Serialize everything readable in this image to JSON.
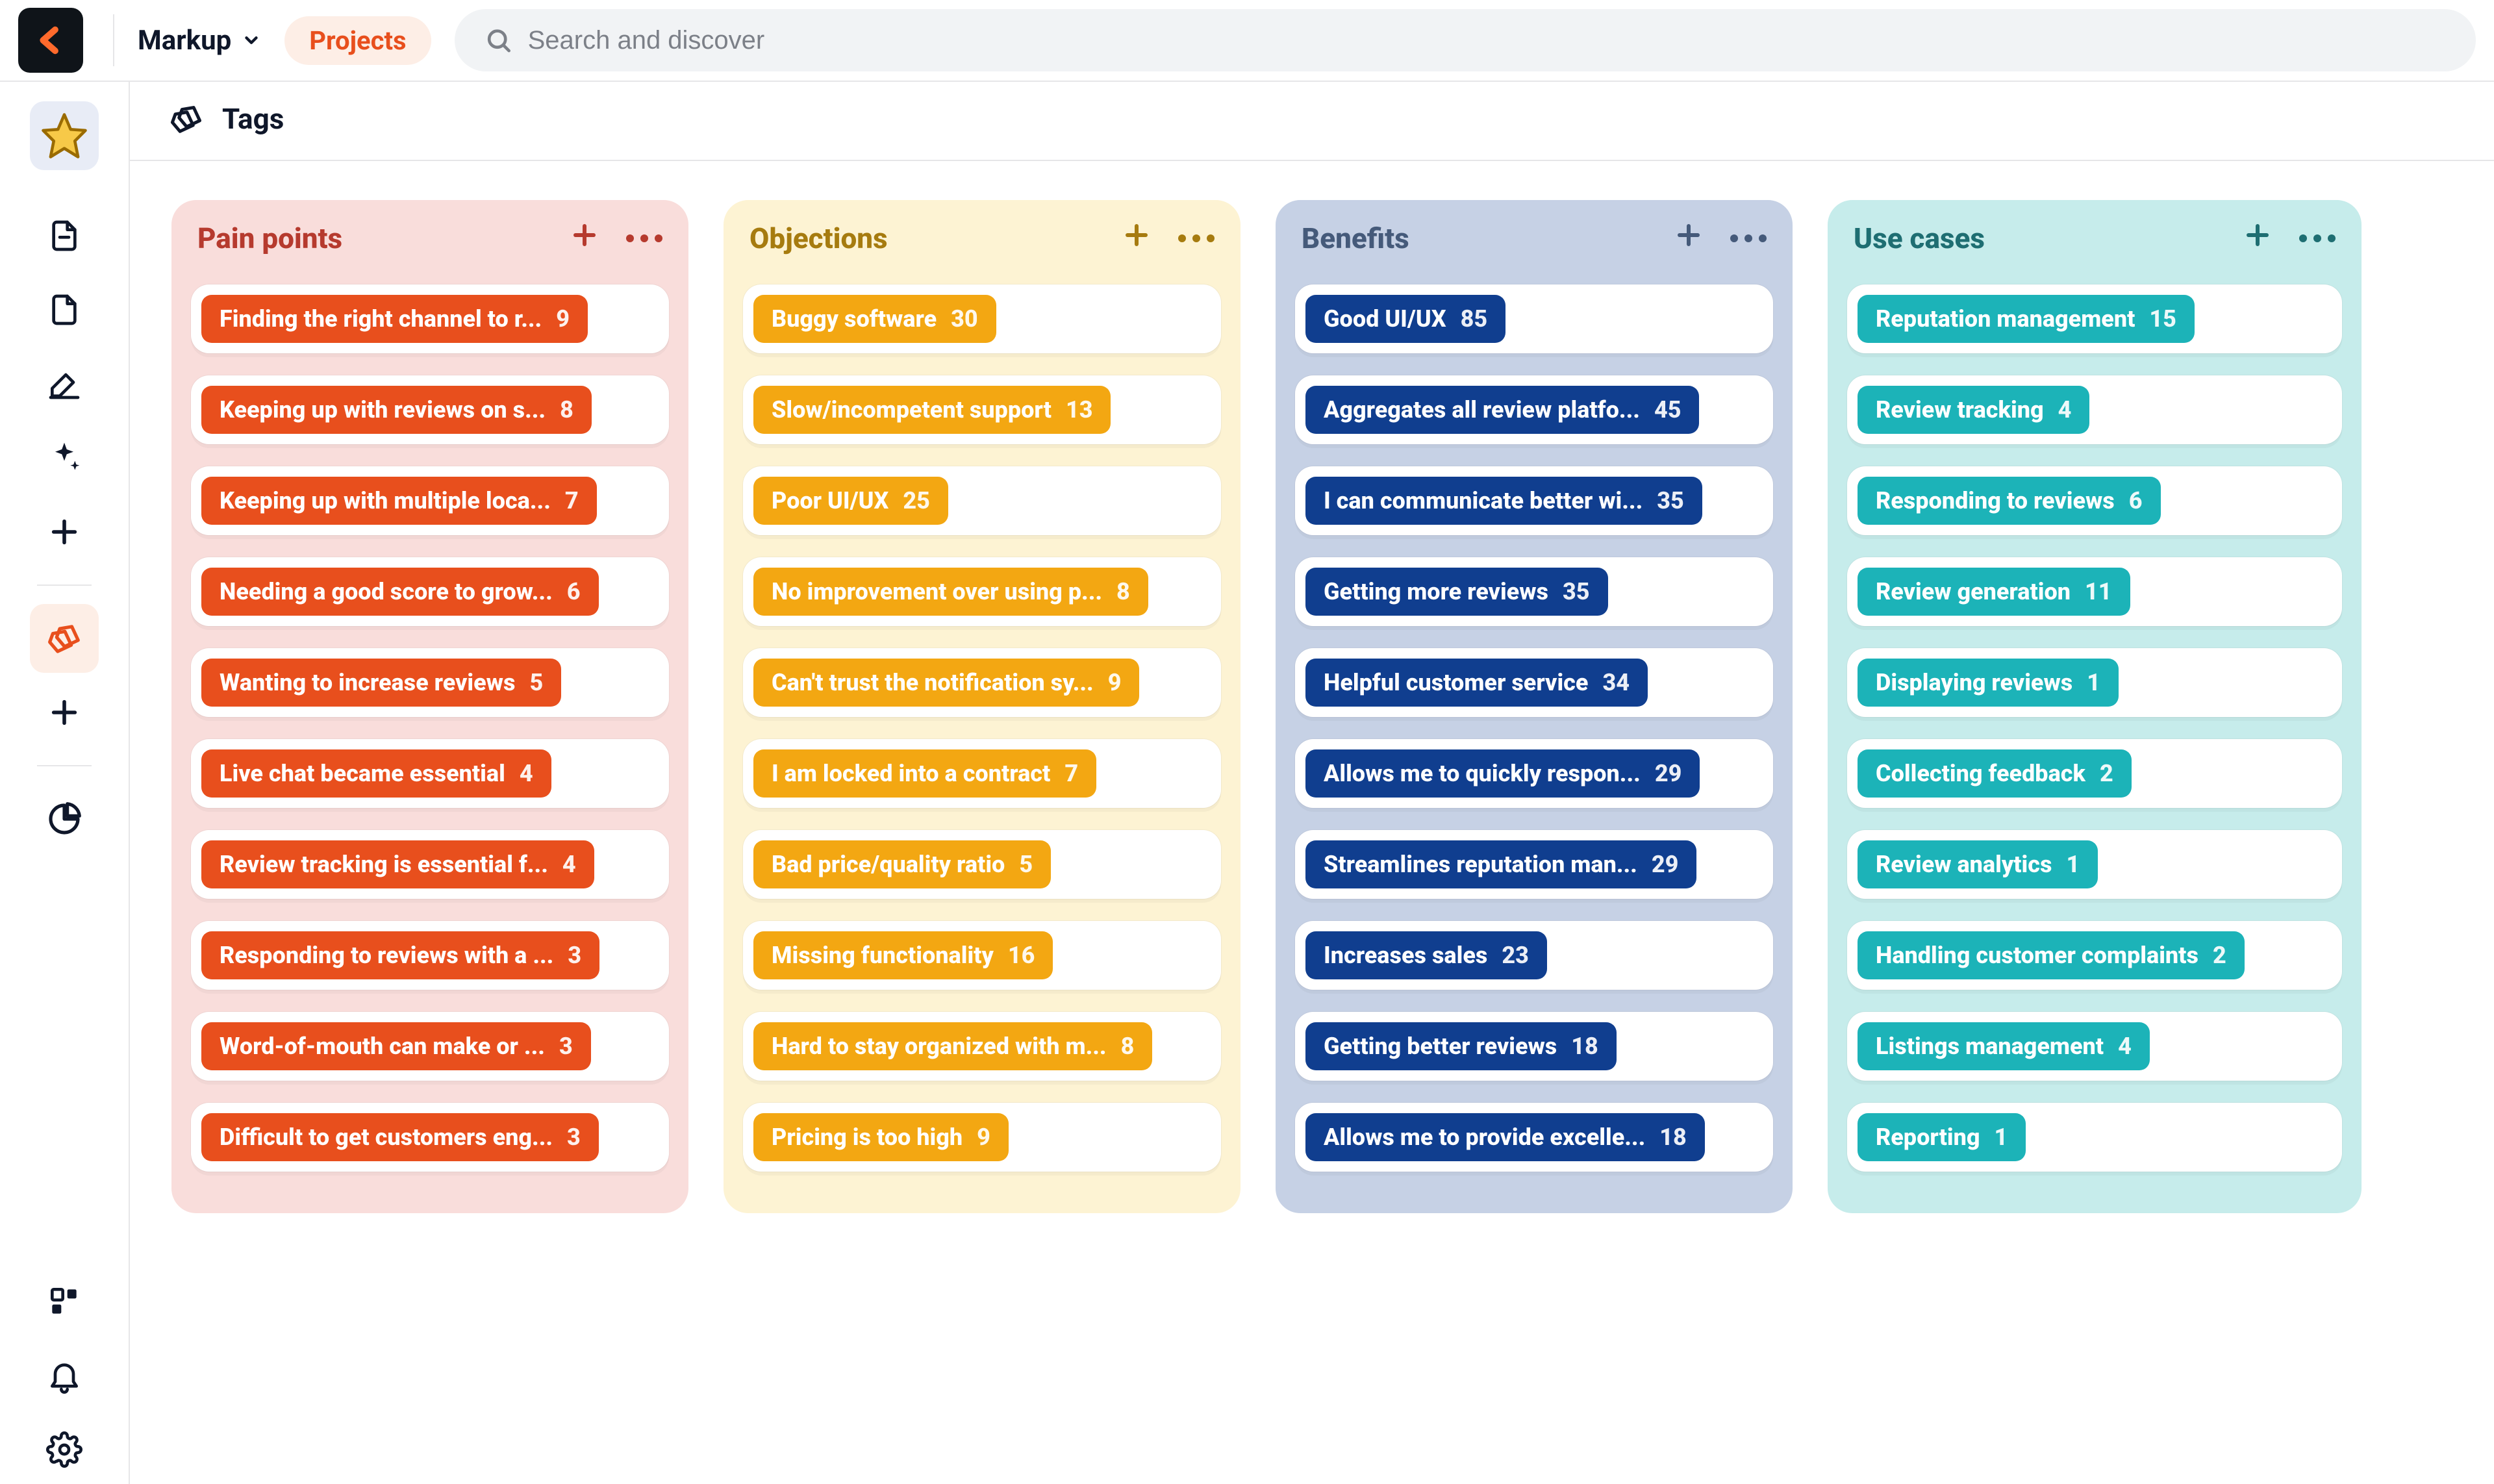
{
  "header": {
    "workspace_name": "Markup",
    "projects_label": "Projects",
    "search_placeholder": "Search and discover"
  },
  "page": {
    "title": "Tags"
  },
  "columns": [
    {
      "id": "pain_points",
      "title": "Pain points",
      "bg_class": "col-pain",
      "title_class": "title-pain",
      "pill_class": "pill-pain",
      "dot_class": "dot-pain",
      "items": [
        {
          "label": "Finding the right channel to r...",
          "count": 9
        },
        {
          "label": "Keeping up with reviews on s...",
          "count": 8
        },
        {
          "label": "Keeping up with multiple loca...",
          "count": 7
        },
        {
          "label": "Needing a good score to grow...",
          "count": 6
        },
        {
          "label": "Wanting to increase reviews",
          "count": 5
        },
        {
          "label": "Live chat became essential",
          "count": 4
        },
        {
          "label": "Review tracking is essential f...",
          "count": 4
        },
        {
          "label": "Responding to reviews with a ...",
          "count": 3
        },
        {
          "label": "Word-of-mouth can make or ...",
          "count": 3
        },
        {
          "label": "Difficult to get customers eng...",
          "count": 3
        }
      ]
    },
    {
      "id": "objections",
      "title": "Objections",
      "bg_class": "col-objs",
      "title_class": "title-objs",
      "pill_class": "pill-objs",
      "dot_class": "dot-objs",
      "items": [
        {
          "label": "Buggy software",
          "count": 30
        },
        {
          "label": "Slow/incompetent support",
          "count": 13
        },
        {
          "label": "Poor UI/UX",
          "count": 25
        },
        {
          "label": "No improvement over using p...",
          "count": 8
        },
        {
          "label": "Can't trust the notification sy...",
          "count": 9
        },
        {
          "label": "I am locked into a contract",
          "count": 7
        },
        {
          "label": "Bad price/quality ratio",
          "count": 5
        },
        {
          "label": "Missing functionality",
          "count": 16
        },
        {
          "label": "Hard to stay organized with m...",
          "count": 8
        },
        {
          "label": "Pricing is too high",
          "count": 9
        }
      ]
    },
    {
      "id": "benefits",
      "title": "Benefits",
      "bg_class": "col-bens",
      "title_class": "title-bens",
      "pill_class": "pill-bens",
      "dot_class": "dot-bens",
      "items": [
        {
          "label": "Good UI/UX",
          "count": 85
        },
        {
          "label": "Aggregates all review platfo...",
          "count": 45
        },
        {
          "label": "I can communicate better wi...",
          "count": 35
        },
        {
          "label": "Getting more reviews",
          "count": 35
        },
        {
          "label": "Helpful customer service",
          "count": 34
        },
        {
          "label": "Allows me to quickly respon...",
          "count": 29
        },
        {
          "label": "Streamlines reputation man...",
          "count": 29
        },
        {
          "label": "Increases sales",
          "count": 23
        },
        {
          "label": "Getting better reviews",
          "count": 18
        },
        {
          "label": "Allows me to provide excelle...",
          "count": 18
        }
      ]
    },
    {
      "id": "use_cases",
      "title": "Use cases",
      "bg_class": "col-uses",
      "title_class": "title-uses",
      "pill_class": "pill-uses",
      "dot_class": "dot-uses",
      "items": [
        {
          "label": "Reputation management",
          "count": 15
        },
        {
          "label": "Review tracking",
          "count": 4
        },
        {
          "label": "Responding to reviews",
          "count": 6
        },
        {
          "label": "Review generation",
          "count": 11
        },
        {
          "label": "Displaying reviews",
          "count": 1
        },
        {
          "label": "Collecting feedback",
          "count": 2
        },
        {
          "label": "Review analytics",
          "count": 1
        },
        {
          "label": "Handling customer complaints",
          "count": 2
        },
        {
          "label": "Listings management",
          "count": 4
        },
        {
          "label": "Reporting",
          "count": 1
        }
      ]
    }
  ]
}
